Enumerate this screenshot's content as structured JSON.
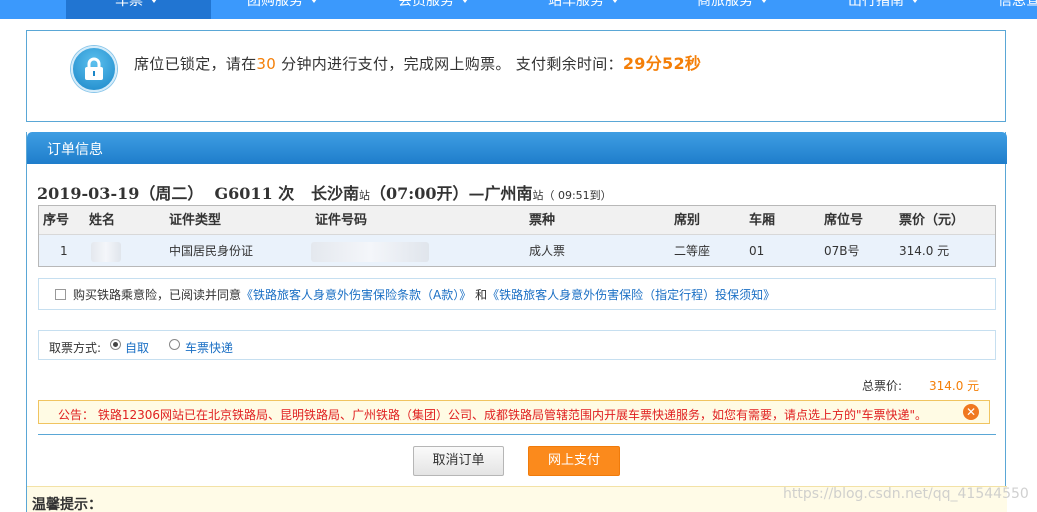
{
  "nav": {
    "items": [
      "车票",
      "团购服务",
      "会员服务",
      "站车服务",
      "商旅服务",
      "出行指南",
      "信息查"
    ]
  },
  "lock": {
    "msg_prefix": "席位已锁定，请在",
    "minutes": "30",
    "msg_mid": " 分钟内进行支付，完成网上购票。 支付剩余时间：",
    "countdown": "29分52秒"
  },
  "order": {
    "header": "订单信息",
    "date": "2019-03-19（周二）",
    "train": "G6011 次",
    "from_station": "长沙南",
    "station_suffix": "站",
    "depart_time": "（07:00开）—",
    "to_station": "广州南",
    "arrive": "（ 09:51到）",
    "columns": [
      "序号",
      "姓名",
      "证件类型",
      "证件号码",
      "票种",
      "席别",
      "车厢",
      "席位号",
      "票价（元）"
    ],
    "rows": [
      {
        "index": "1",
        "id_type": "中国居民身份证",
        "ticket_type": "成人票",
        "seat_class": "二等座",
        "car": "01",
        "seat_no": "07B号",
        "price": "314.0 元"
      }
    ]
  },
  "insurance": {
    "prefix": "购买铁路乘意险，已阅读并同意",
    "link1": "《铁路旅客人身意外伤害保险条款（A款）》",
    "and": "和",
    "link2": "《铁路旅客人身意外伤害保险（指定行程）投保须知》"
  },
  "pickup": {
    "label": "取票方式:",
    "option_self": "自取",
    "option_express": "车票快递",
    "selected": "自取"
  },
  "total": {
    "label": "总票价:",
    "value": "314.0 元"
  },
  "notice": {
    "text": "公告：  铁路12306网站已在北京铁路局、昆明铁路局、广州铁路（集团）公司、成都铁路局管辖范围内开展车票快递服务，如您有需要，请点选上方的\"车票快递\"。"
  },
  "buttons": {
    "cancel": "取消订单",
    "pay": "网上支付"
  },
  "tips": {
    "title": "温馨提示："
  },
  "watermark": "https://blog.csdn.net/qq_41544550",
  "colors": {
    "nav_bg": "#3b99fc",
    "accent_orange": "#f47f08",
    "header_blue": "#1f7dcb",
    "notice_red": "#e02020"
  }
}
